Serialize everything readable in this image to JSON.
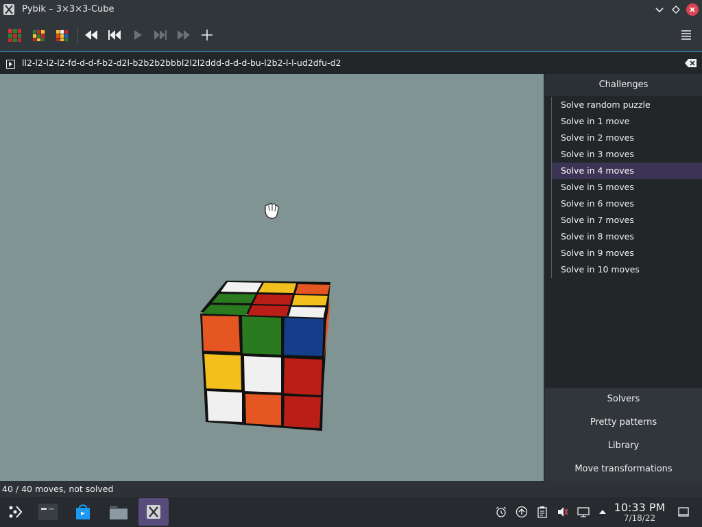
{
  "window": {
    "title": "Pybik – 3×3×3-Cube"
  },
  "toolbar": {
    "items": [
      "game-menu",
      "rewind",
      "previous",
      "play",
      "next",
      "forward",
      "add-mark"
    ]
  },
  "moves": {
    "text": "ll2-l2-l2-l2-fd-d-d-f-b2-d2l-b2b2b2bbbl2l2l2ddd-d-d-d-bu-l2b2-l-l-ud2dfu-d2"
  },
  "sidebar": {
    "header": "Challenges",
    "items": [
      "Solve random puzzle",
      "Solve in 1 move",
      "Solve in 2 moves",
      "Solve in 3 moves",
      "Solve in 4 moves",
      "Solve in 5 moves",
      "Solve in 6 moves",
      "Solve in 7 moves",
      "Solve in 8 moves",
      "Solve in 9 moves",
      "Solve in 10 moves"
    ],
    "selected": "Solve in 4 moves",
    "sections": [
      "Solvers",
      "Pretty patterns",
      "Library",
      "Move transformations"
    ]
  },
  "status": {
    "text": "40 / 40 moves, not solved"
  },
  "clock": {
    "time": "10:33 PM",
    "date": "7/18/22"
  },
  "colors": {
    "accent": "#3daee9",
    "selection": "#3c3455",
    "viewport": "#7f9493"
  }
}
